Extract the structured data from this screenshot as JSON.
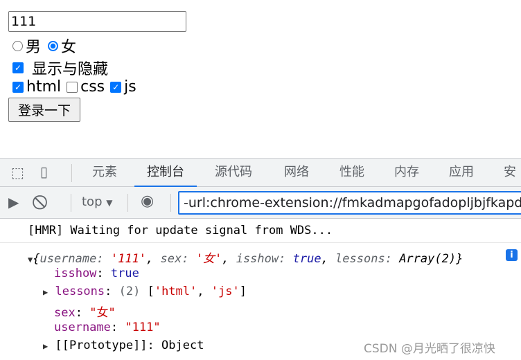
{
  "form": {
    "input_value": "111",
    "radio_male": "男",
    "radio_female": "女",
    "sex_selected": "女",
    "toggle_label": "显示与隐藏",
    "toggle_checked": true,
    "lessons": [
      {
        "label": "html",
        "checked": true
      },
      {
        "label": "css",
        "checked": false
      },
      {
        "label": "js",
        "checked": true
      }
    ],
    "submit": "登录一下"
  },
  "devtools": {
    "tabs": [
      "元素",
      "控制台",
      "源代码",
      "网络",
      "性能",
      "内存",
      "应用",
      "安全"
    ],
    "active_tab": "控制台",
    "context": "top",
    "filter": "-url:chrome-extension://fmkadmapgofadopljbjfkapdkoienihi"
  },
  "console": {
    "hmr": "[HMR] Waiting for update signal from WDS...",
    "summary": {
      "open": "{",
      "k1": "username",
      "v1": "'111'",
      "k2": "sex",
      "v2": "'女'",
      "k3": "isshow",
      "v3": "true",
      "k4": "lessons",
      "v4": "Array(2)",
      "close": "}"
    },
    "props": {
      "isshow_k": "isshow",
      "isshow_v": "true",
      "lessons_k": "lessons",
      "lessons_count": "(2)",
      "lessons_a": "'html'",
      "lessons_b": "'js'",
      "sex_k": "sex",
      "sex_v": "\"女\"",
      "username_k": "username",
      "username_v": "\"111\"",
      "proto_k": "[[Prototype]]",
      "proto_v": "Object"
    }
  },
  "watermark": "CSDN @月光晒了很凉快"
}
